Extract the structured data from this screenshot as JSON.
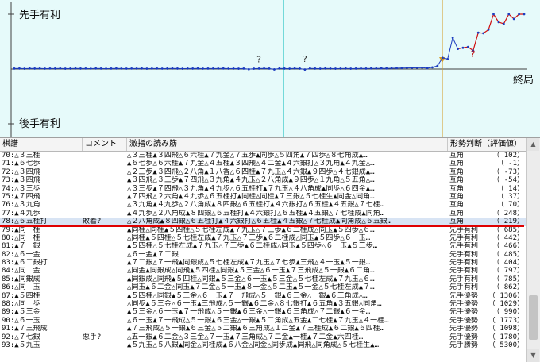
{
  "graph": {
    "label_top": "先手有利",
    "label_bottom": "後手有利",
    "label_end": "終局",
    "question_marks": [
      {
        "move": 48,
        "value": 12
      },
      {
        "move": 57,
        "value": 14
      },
      {
        "move": 90,
        "value": 130
      }
    ],
    "scores": [
      10,
      12,
      8,
      14,
      10,
      12,
      9,
      11,
      10,
      12,
      8,
      10,
      12,
      10,
      11,
      9,
      12,
      10,
      8,
      10,
      12,
      10,
      9,
      11,
      10,
      12,
      8,
      10,
      11,
      9,
      10,
      12,
      10,
      8,
      11,
      10,
      12,
      9,
      10,
      11,
      10,
      12,
      9,
      10,
      8,
      10,
      -5,
      8,
      10,
      12,
      10,
      -8,
      12,
      10,
      8,
      12,
      10,
      -10,
      14,
      10,
      8,
      12,
      10,
      8,
      10,
      12,
      8,
      10,
      12,
      10,
      14,
      12,
      16,
      14,
      18,
      20,
      22,
      24,
      26,
      28,
      30,
      20,
      37,
      70,
      248,
      219,
      685,
      442,
      466,
      485,
      404,
      797,
      785,
      862,
      1306,
      1029,
      990,
      1773,
      1098,
      1780,
      5300
    ],
    "xmax": 101,
    "y_range": [
      -1200,
      1200
    ],
    "current_move": 78,
    "colors": {
      "bg": "#e6fafa",
      "line": "#1c3cbf",
      "center": "#00b8b8",
      "cursor": "#d49a20",
      "final": "#d01010"
    }
  },
  "table": {
    "headers": [
      "棋譜",
      "コメント",
      "激指の読み筋",
      "形勢判断（評価値）"
    ],
    "rows": [
      [
        "70:△３三桂",
        "",
        "△３三桂▲３四飛△６六桂▲７九金△７五歩▲同歩△５四角▲７四歩△８七角成▲…",
        "互角",
        "（  102）"
      ],
      [
        "71:▲６七歩",
        "",
        "▲６七歩△６六桂▲７九金△４五桂▲３四飛△４二金▲４六銀打△３九角▲４九金△…",
        "互角",
        "（   -1）"
      ],
      [
        "72:△３四飛",
        "",
        "△２三歩▲３四飛△２八角▲１八香△６四桂▲７九玉△４六銀▲９四歩△４七銀成▲…",
        "互角",
        "（  -73）"
      ],
      [
        "73:▲３四飛",
        "",
        "▲３四飛△３三歩▲７四飛△３九角▲４九玉△２八角成▲９四歩△１九角△５五角△…",
        "互角",
        "（  -54）"
      ],
      [
        "74:△３三歩",
        "",
        "△３三歩▲７四飛△３九角▲４九歩△６五桂打▲７九玉△４八角成▲同歩△６四金▲…",
        "互角",
        "（   14）"
      ],
      [
        "75:▲７四飛",
        "",
        "▲７四飛△２六角▲４九歩△６五桂打▲同桂△同桂▲７三銀△５七桂生▲同金△同角…",
        "互角",
        "（   37）"
      ],
      [
        "76:△３九角",
        "",
        "△３九角▲４九歩△２八角成▲８四銀△６五桂打▲４六銀打△６五桂▲４五銀△７七桂…",
        "互角",
        "（   70）"
      ],
      [
        "77:▲４九歩",
        "",
        "▲４九歩△２八角成▲８四銀△６五桂打▲４六銀打△６五桂▲４五銀△７七桂成▲同角…",
        "互角",
        "（  248）"
      ],
      [
        "78:△６五桂打",
        "敗着?",
        "△２八角成▲８四銀△６五桂打▲４六銀打△６五桂▲４五銀△７七桂成▲同角成△６五銀…",
        "互角",
        "（  219）"
      ],
      [
        "79:▲同　桂",
        "",
        "▲同桂△同桂▲５四桂△５七桂左成▲７九玉△７三歩▲６二桂成△同玉▲５四歩△６…",
        "先手有利",
        "（  685）"
      ],
      [
        "80:△同　桂",
        "",
        "△同桂▲５四桂△５七桂左成▲７九玉△７三歩▲６二桂成△同玉▲５四歩△６一玉…",
        "先手有利",
        "（  442）"
      ],
      [
        "81:▲７一銀",
        "",
        "▲５四桂△５七桂左成▲７九玉△７三歩▲６二桂成△同玉▲５四歩△６一玉▲５三歩…",
        "先手有利",
        "（  466）"
      ],
      [
        "82:△６一金",
        "",
        "△６一金▲７二銀",
        "先手有利",
        "（  485）"
      ],
      [
        "83:▲６二銀打",
        "",
        "▲７二銀△７一飛▲同銀成△５七桂左成▲７九玉△７七歩▲三飛△４一玉▲５一銀…",
        "先手有利",
        "（  404）"
      ],
      [
        "84:△同　金",
        "",
        "△同金▲同銀成△同飛▲５四桂△同銀▲５三金△６一玉▲７三飛成△５一銀▲６二角…",
        "先手有利",
        "（  797）"
      ],
      [
        "85:▲同銀成",
        "",
        "▲同銀成△同飛▲５四桂△同銀▲５三金△６一玉▲５三金△５七桂左成▲７九玉△６…",
        "先手有利",
        "（  785）"
      ],
      [
        "86:△同　玉",
        "",
        "△同玉▲６二金△同玉▲７二金△５一玉▲８一金△５二玉▲５一金△５七桂左成▲７…",
        "先手有利",
        "（  862）"
      ],
      [
        "87:▲５四桂",
        "",
        "▲５四桂△同銀▲５三金△６一玉▲７一飛成△５一銀▲６三金△一銀▲６三角成△…",
        "先手優勢",
        "（ 1306）"
      ],
      [
        "88:△同　歩",
        "",
        "△同歩▲５三金△６一玉▲三飛成△５一銀▲６二金△８七銀打▲６五角▲３五銀△同角…",
        "先手優勢",
        "（ 1029）"
      ],
      [
        "89:▲５三金",
        "",
        "▲５三金△６一玉▲７一飛成△５一銀▲６三金△一銀▲６三角成△７二銀▲６一金…",
        "先手優勢",
        "（  990）"
      ],
      [
        "90:△６一玉",
        "",
        "△６一玉▲７一飛成△５一銀▲６三金△一銀▲５二角成△五金▲二七桂▲７九玉△４一桂…",
        "先手優勢",
        "（ 1773）"
      ],
      [
        "91:▲７三飛成",
        "",
        "▲７三飛成△５一銀▲６三金△５二銀▲６三角成△１二金▲７三桂成▲６二銀▲６四桂…",
        "先手優勢",
        "（ 1098）"
      ],
      [
        "92:△７七銀",
        "悪手?",
        "△五一銀▲６二金△３三金△７一玉▲７三角成△７二金▲一桂▲７二金▲六四桂…",
        "先手優勢",
        "（ 1780）"
      ],
      [
        "93:▲５九玉",
        "",
        "▲５九玉△５八銀▲同金△同桂成▲６八金△同金△同歩成▲同飛△同角成△５七桂生▲…",
        "先手勝勢",
        "（ 5300）"
      ]
    ],
    "selected_row": 8
  }
}
